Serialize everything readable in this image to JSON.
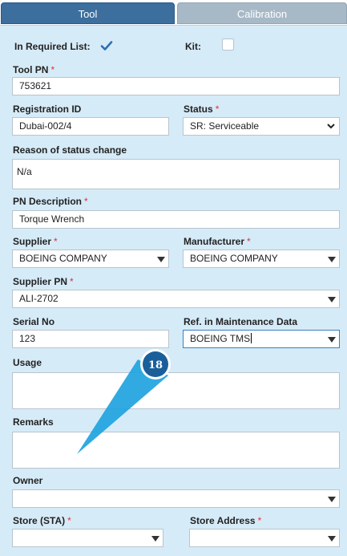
{
  "tabs": [
    {
      "label": "Tool",
      "active": true
    },
    {
      "label": "Calibration",
      "active": false
    }
  ],
  "form": {
    "in_required_list": {
      "label": "In Required List:",
      "checked": true
    },
    "kit": {
      "label": "Kit:",
      "checked": false
    },
    "tool_pn": {
      "label": "Tool PN",
      "required": "*",
      "value": "753621"
    },
    "registration_id": {
      "label": "Registration ID",
      "value": "Dubai-002/4"
    },
    "status": {
      "label": "Status",
      "required": "*",
      "value": "SR: Serviceable"
    },
    "reason": {
      "label": "Reason of status change",
      "value": "N/a"
    },
    "pn_description": {
      "label": "PN Description",
      "required": "*",
      "value": "Torque Wrench"
    },
    "supplier": {
      "label": "Supplier",
      "required": "*",
      "value": "BOEING COMPANY"
    },
    "manufacturer": {
      "label": "Manufacturer",
      "required": "*",
      "value": "BOEING COMPANY"
    },
    "supplier_pn": {
      "label": "Supplier PN",
      "required": "*",
      "value": "ALI-2702"
    },
    "serial_no": {
      "label": "Serial No",
      "value": "123"
    },
    "ref_maintenance": {
      "label": "Ref. in Maintenance Data",
      "value": "BOEING TMS"
    },
    "usage": {
      "label": "Usage",
      "value": ""
    },
    "remarks": {
      "label": "Remarks",
      "value": ""
    },
    "owner": {
      "label": "Owner",
      "value": ""
    },
    "store_sta": {
      "label": "Store (STA)",
      "required": "*",
      "value": ""
    },
    "store_address": {
      "label": "Store Address",
      "required": "*",
      "value": ""
    }
  },
  "annotation": {
    "number": "18"
  },
  "colors": {
    "tab_active": "#3c6e9e",
    "tab_inactive": "#a7b9c7",
    "panel_bg": "#d6ebf8",
    "required_star": "#e0313b",
    "checkbox_check": "#2f6fb3",
    "callout_fill": "#1fa3e0",
    "callout_badge": "#1a5f9a"
  }
}
